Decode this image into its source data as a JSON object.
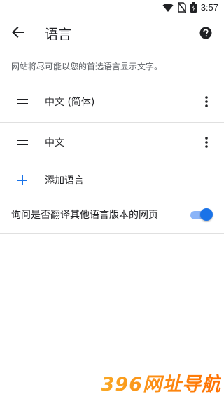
{
  "status_bar": {
    "time": "3:57"
  },
  "header": {
    "title": "语言"
  },
  "description": "网站将尽可能以您的首选语言显示文字。",
  "languages": [
    {
      "label": "中文 (简体)"
    },
    {
      "label": "中文"
    }
  ],
  "add_language_label": "添加语言",
  "translate_toggle": {
    "label": "询问是否翻译其他语言版本的网页",
    "on": true
  },
  "watermark": "396网址导航",
  "colors": {
    "accent": "#1a73e8",
    "toggle_track": "#8ab4f8"
  }
}
